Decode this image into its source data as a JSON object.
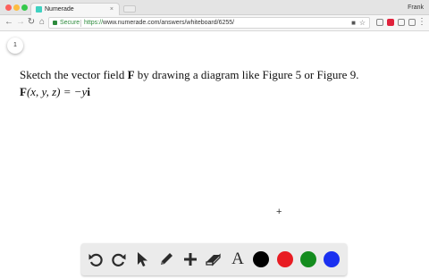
{
  "browser": {
    "tab_title": "Numerade",
    "tab_close": "×",
    "profile_name": "Frank",
    "secure_label": "Secure",
    "url_scheme": "https://",
    "url_rest": "www.numerade.com/answers/whiteboard/6255/"
  },
  "page": {
    "page_number": "1"
  },
  "question": {
    "sentence_start": "Sketch the vector field ",
    "sentence_bold": "F",
    "sentence_end": " by drawing a diagram like Figure 5 or Figure 9.",
    "formula_bold_F": "F",
    "formula_args": "(x, y, z) = −y",
    "formula_bold_i": "i"
  },
  "canvas": {
    "cursor_glyph": "+"
  },
  "toolbar": {
    "tools": [
      "undo-icon",
      "redo-icon",
      "pointer-icon",
      "pencil-icon",
      "plus-icon",
      "eraser-icon",
      "text-icon"
    ],
    "text_tool_glyph": "A",
    "colors": [
      "#000000",
      "#e81c23",
      "#148c1e",
      "#1a30f0"
    ]
  }
}
